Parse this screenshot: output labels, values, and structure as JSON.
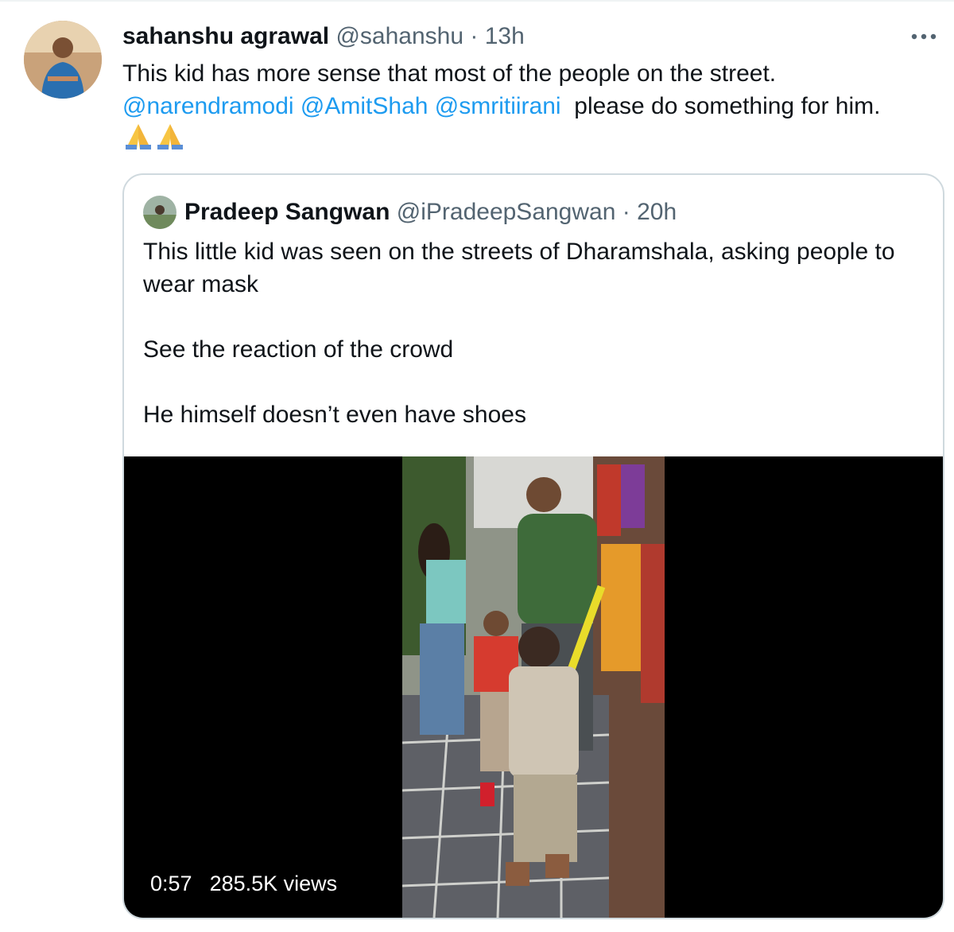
{
  "tweet": {
    "author_name": "sahanshu agrawal",
    "author_handle": "@sahanshu",
    "separator": "·",
    "time": "13h",
    "text_line1": "This kid has more sense that most of the people on the street.",
    "mention1": "@narendramodi",
    "mention2": "@AmitShah",
    "mention3": "@smritiirani",
    "text_line2_rest": "please do something for him.",
    "emoji": "folded-hands-emoji x2",
    "more_icon": "more-horizontal-icon"
  },
  "quoted": {
    "author_name": "Pradeep Sangwan",
    "author_handle": "@iPradeepSangwan",
    "separator": "·",
    "time": "20h",
    "paragraphs": [
      "This little kid was seen on the streets of Dharamshala, asking people to wear mask",
      "See the reaction of the crowd",
      "He himself doesn’t even have shoes"
    ],
    "video": {
      "duration": "0:57",
      "views": "285.5K views"
    }
  },
  "colors": {
    "link": "#1d9bf0",
    "muted": "#536471",
    "text": "#0f1419",
    "border": "#cfd9de"
  }
}
